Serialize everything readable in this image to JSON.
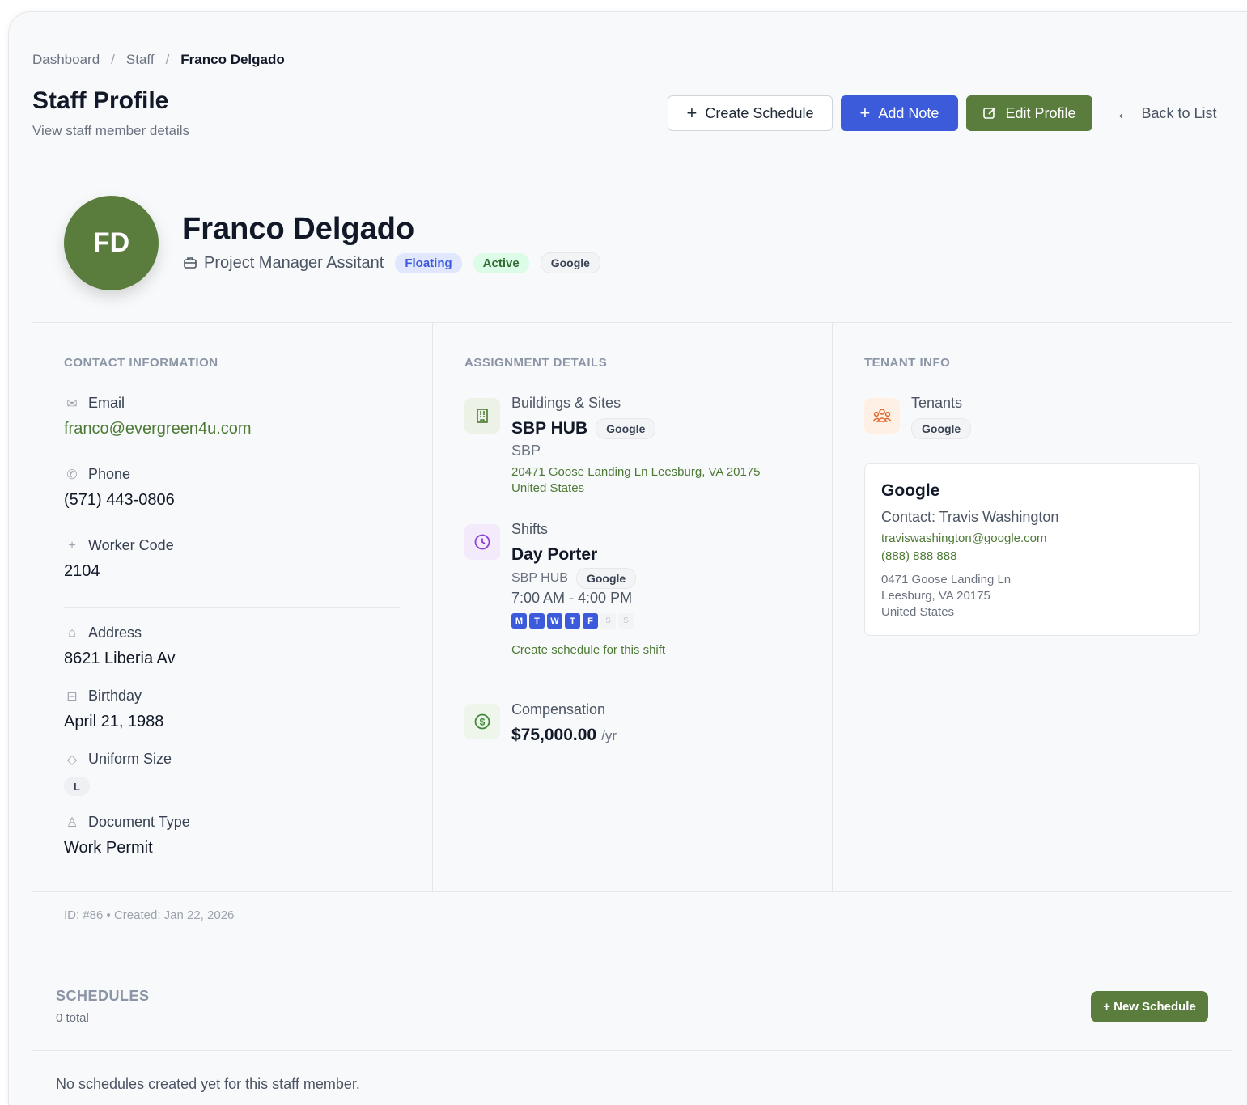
{
  "breadcrumb": {
    "items": [
      "Dashboard",
      "Staff",
      "Franco Delgado"
    ],
    "separator": "/"
  },
  "header": {
    "title": "Staff Profile",
    "subtitle": "View staff member details",
    "create_schedule": "Create Schedule",
    "add_note": "Add Note",
    "edit_profile": "Edit Profile",
    "back": "Back to List"
  },
  "profile": {
    "initials": "FD",
    "name": "Franco Delgado",
    "role": "Project Manager Assitant",
    "badges": {
      "floating": "Floating",
      "status": "Active",
      "tenant": "Google"
    }
  },
  "contact": {
    "section": "CONTACT INFORMATION",
    "email_label": "Email",
    "email": "franco@evergreen4u.com",
    "phone_label": "Phone",
    "phone": "(571) 443-0806",
    "worker_label": "Worker Code",
    "worker": "2104",
    "address_label": "Address",
    "address": "8621 Liberia Av",
    "birthday_label": "Birthday",
    "birthday": "April 21, 1988",
    "uniform_label": "Uniform Size",
    "uniform": "L",
    "doc_label": "Document Type",
    "doc": "Work Permit"
  },
  "assignment": {
    "section": "ASSIGNMENT DETAILS",
    "buildings_label": "Buildings & Sites",
    "building_name": "SBP HUB",
    "building_tag": "Google",
    "building_code": "SBP",
    "building_addr1": "20471 Goose Landing Ln Leesburg, VA 20175",
    "building_addr2": "United States",
    "shifts_label": "Shifts",
    "shift_name": "Day Porter",
    "shift_site": "SBP HUB",
    "shift_tag": "Google",
    "shift_time": "7:00 AM - 4:00 PM",
    "days": [
      "M",
      "T",
      "W",
      "T",
      "F",
      "S",
      "S"
    ],
    "create_shift_schedule": "Create schedule for this shift",
    "comp_label": "Compensation",
    "comp_value": "$75,000.00",
    "comp_unit": "/yr"
  },
  "tenant": {
    "section": "TENANT INFO",
    "tenants_label": "Tenants",
    "tenant_tag": "Google",
    "card_name": "Google",
    "card_contact": "Contact: Travis Washington",
    "card_email": "traviswashington@google.com",
    "card_phone": "(888) 888 888",
    "card_addr1": "0471 Goose Landing Ln",
    "card_addr2": "Leesburg, VA 20175",
    "card_addr3": "United States"
  },
  "meta": "ID: #86 • Created: Jan 22, 2026",
  "schedules": {
    "title": "SCHEDULES",
    "total": "0 total",
    "new_button": "+ New Schedule",
    "empty": "No schedules created yet for this staff member."
  },
  "colors": {
    "primary_green": "#5a7d3e",
    "primary_blue": "#3b5bdb"
  }
}
